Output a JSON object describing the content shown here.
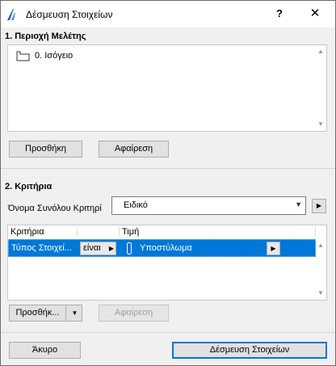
{
  "window": {
    "title": "Δέσμευση Στοιχείων",
    "help_label": "?",
    "close_label": "✕"
  },
  "section1": {
    "header": "1. Περιοχή Μελέτης",
    "stories": [
      {
        "label": "0. Ισόγειο",
        "icon": "story-floor-icon"
      }
    ],
    "add_button": "Προσθήκη",
    "remove_button": "Αφαίρεση"
  },
  "section2": {
    "header": "2. Κριτήρια",
    "criteria_set_label": "Όνομα Συνόλου Κριτηρί",
    "criteria_set_value": "Ειδικό",
    "table": {
      "columns": [
        "Κριτήρια",
        "Τιμή"
      ],
      "rows": [
        {
          "criterion": "Τύπος Στοιχεί...",
          "operator": "είναι",
          "value": "Υποστύλωμα",
          "value_icon": "column-icon",
          "selected": true
        }
      ]
    },
    "add_button": "Προσθήκ...",
    "remove_button": "Αφαίρεση"
  },
  "footer": {
    "cancel_button": "Άκυρο",
    "confirm_button": "Δέσμευση Στοιχείων"
  },
  "colors": {
    "selection": "#0078d7",
    "title_background": "#ffffff",
    "dialog_background": "#f0f0f0"
  }
}
